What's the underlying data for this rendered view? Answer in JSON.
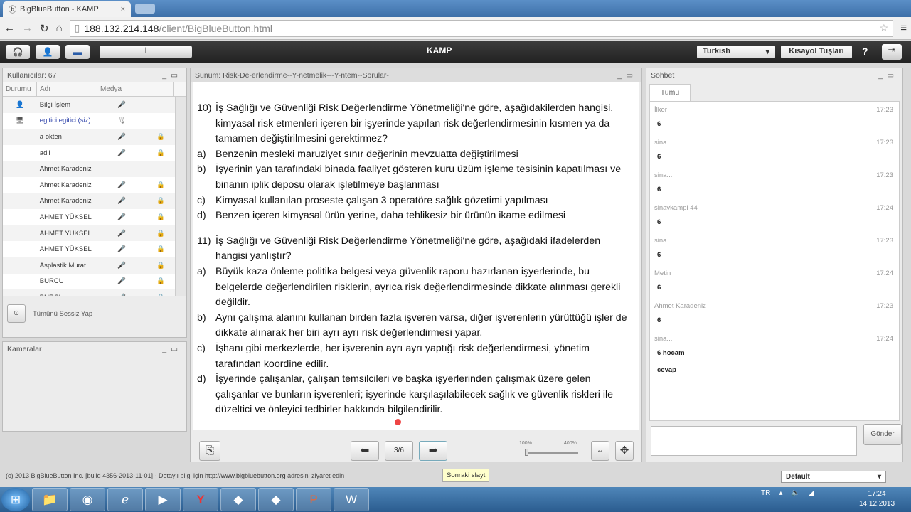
{
  "browser": {
    "tab_title": "BigBlueButton - KAMP",
    "url_host": "188.132.214.148",
    "url_path": "/client/BigBlueButton.html"
  },
  "toolbar": {
    "title": "KAMP",
    "language": "Turkish",
    "shortcuts": "Kısayol Tuşları",
    "help": "?"
  },
  "users": {
    "title": "Kullanıcılar: 67",
    "headers": [
      "Durumu",
      "Adı",
      "Medya"
    ],
    "rows": [
      {
        "name": "Bilgi İşlem",
        "status": "👤",
        "media": "🎤",
        "lock": ""
      },
      {
        "name": "egitici egitici (siz)",
        "status": "🖥",
        "media": "🎙",
        "lock": "",
        "me": true
      },
      {
        "name": "a okten",
        "status": "",
        "media": "🎤",
        "lock": "🔒"
      },
      {
        "name": "adil",
        "status": "",
        "media": "🎤",
        "lock": "🔒"
      },
      {
        "name": "Ahmet Karadeniz",
        "status": "",
        "media": "",
        "lock": ""
      },
      {
        "name": "Ahmet Karadeniz",
        "status": "",
        "media": "🎤",
        "lock": "🔒"
      },
      {
        "name": "Ahmet Karadeniz",
        "status": "",
        "media": "🎤",
        "lock": "🔒"
      },
      {
        "name": "AHMET YÜKSEL",
        "status": "",
        "media": "🎤",
        "lock": "🔒"
      },
      {
        "name": "AHMET YÜKSEL",
        "status": "",
        "media": "🎤",
        "lock": "🔒"
      },
      {
        "name": "AHMET YÜKSEL",
        "status": "",
        "media": "🎤",
        "lock": "🔒"
      },
      {
        "name": "Asplastik Murat",
        "status": "",
        "media": "🎤",
        "lock": "🔒"
      },
      {
        "name": "BURCU",
        "status": "",
        "media": "🎤",
        "lock": "🔒"
      },
      {
        "name": "BURCU",
        "status": "",
        "media": "🎤",
        "lock": "🔒"
      }
    ],
    "mute_all": "Tümünü Sessiz Yap"
  },
  "cameras": {
    "title": "Kameralar"
  },
  "presentation": {
    "title": "Sunum: Risk-De-erlendirme--Y-netmelik---Y-ntem--Sorular-",
    "questions": [
      {
        "num": "10)",
        "text": "İş Sağlığı ve Güvenliği Risk Değerlendirme Yönetmeliği'ne göre, aşağıdakilerden hangisi, kimyasal risk etmenleri içeren bir işyerinde yapılan risk değerlendirmesinin kısmen ya da tamamen değiştirilmesini gerektirmez?",
        "options": [
          {
            "l": "a)",
            "t": "Benzenin mesleki maruziyet sınır değerinin mevzuatta değiştirilmesi"
          },
          {
            "l": "b)",
            "t": "İşyerinin yan tarafındaki binada faaliyet gösteren kuru üzüm işleme tesisinin kapatılması ve binanın iplik deposu olarak işletilmeye başlanması"
          },
          {
            "l": "c)",
            "t": "Kimyasal kullanılan proseste çalışan 3 operatöre sağlık gözetimi yapılması"
          },
          {
            "l": "d)",
            "t": "Benzen içeren kimyasal ürün yerine, daha tehlikesiz bir ürünün ikame edilmesi"
          }
        ]
      },
      {
        "num": "11)",
        "text": "İş Sağlığı ve Güvenliği Risk Değerlendirme Yönetmeliği'ne göre, aşağıdaki ifadelerden hangisi yanlıştır?",
        "options": [
          {
            "l": "a)",
            "t": "Büyük kaza önleme politika belgesi veya güvenlik raporu hazırlanan işyerlerinde, bu belgelerde değerlendirilen risklerin, ayrıca risk değerlendirmesinde dikkate alınması gerekli değildir."
          },
          {
            "l": "b)",
            "t": "Aynı çalışma alanını kullanan birden fazla işveren varsa, diğer işverenlerin yürüttüğü işler de dikkate alınarak her biri ayrı ayrı risk değerlendirmesi yapar."
          },
          {
            "l": "c)",
            "t": "İşhanı gibi merkezlerde, her işverenin ayrı ayrı yaptığı risk değerlendirmesi, yönetim tarafından koordine edilir."
          },
          {
            "l": "d)",
            "t": "İşyerinde çalışanlar, çalışan temsilcileri ve başka işyerlerinden çalışmak üzere gelen çalışanlar ve bunların işverenleri; işyerinde karşılaşılabilecek sağlık ve güvenlik riskleri ile düzeltici ve önleyici tedbirler hakkında bilgilendirilir."
          }
        ]
      }
    ],
    "page": "3/6",
    "zoom_min": "100%",
    "zoom_max": "400%",
    "zoom_value": 0,
    "next_tooltip": "Sonraki slayt"
  },
  "chat": {
    "title": "Sohbet",
    "tab": "Tumu",
    "send": "Gönder",
    "messages": [
      {
        "from": "İlker",
        "time": "17:23",
        "text": "6"
      },
      {
        "from": "sina...",
        "time": "17:23",
        "text": "6"
      },
      {
        "from": "sina...",
        "time": "17:23",
        "text": "6"
      },
      {
        "from": "sinavkampi 44",
        "time": "17:24",
        "text": "6"
      },
      {
        "from": "sina...",
        "time": "17:23",
        "text": "6"
      },
      {
        "from": "Metin",
        "time": "17:24",
        "text": "6"
      },
      {
        "from": "Ahmet Karadeniz",
        "time": "17:23",
        "text": "6"
      },
      {
        "from": "sina...",
        "time": "17:24",
        "text": "6 hocam",
        "extra": "cevap"
      }
    ]
  },
  "footer": {
    "text": "(c) 2013 BigBlueButton Inc. [build 4356-2013-11-01] - Detaylı bilgi için",
    "link": "http://www.bigbluebutton.org",
    "after": "adresini ziyaret edin",
    "layout": "Default"
  },
  "taskbar": {
    "lang": "TR",
    "time": "17:24",
    "date": "14.12.2013"
  }
}
